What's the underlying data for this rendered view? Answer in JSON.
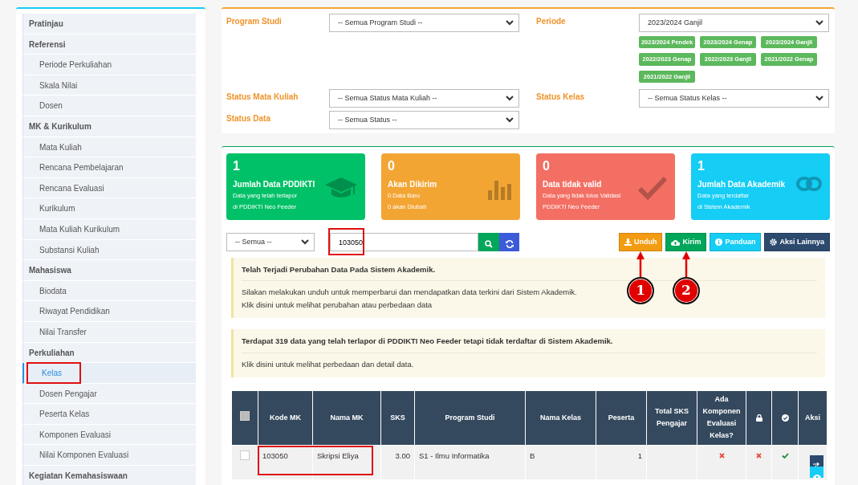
{
  "sidebar": {
    "items": [
      {
        "label": "Pratinjau",
        "kind": "header",
        "selected": false,
        "highlighted": false
      },
      {
        "label": "Referensi",
        "kind": "header",
        "selected": false,
        "highlighted": false
      },
      {
        "label": "Periode Perkuliahan",
        "kind": "link",
        "selected": false,
        "highlighted": false
      },
      {
        "label": "Skala Nilai",
        "kind": "link",
        "selected": false,
        "highlighted": false
      },
      {
        "label": "Dosen",
        "kind": "link",
        "selected": false,
        "highlighted": false
      },
      {
        "label": "MK & Kurikulum",
        "kind": "header",
        "selected": false,
        "highlighted": false
      },
      {
        "label": "Mata Kuliah",
        "kind": "link",
        "selected": false,
        "highlighted": false
      },
      {
        "label": "Rencana Pembelajaran",
        "kind": "link",
        "selected": false,
        "highlighted": false
      },
      {
        "label": "Rencana Evaluasi",
        "kind": "link",
        "selected": false,
        "highlighted": false
      },
      {
        "label": "Kurikulum",
        "kind": "link",
        "selected": false,
        "highlighted": false
      },
      {
        "label": "Mata Kuliah Kurikulum",
        "kind": "link",
        "selected": false,
        "highlighted": false
      },
      {
        "label": "Substansi Kuliah",
        "kind": "link",
        "selected": false,
        "highlighted": false
      },
      {
        "label": "Mahasiswa",
        "kind": "header",
        "selected": false,
        "highlighted": false
      },
      {
        "label": "Biodata",
        "kind": "link",
        "selected": false,
        "highlighted": false
      },
      {
        "label": "Riwayat Pendidikan",
        "kind": "link",
        "selected": false,
        "highlighted": false
      },
      {
        "label": "Nilai Transfer",
        "kind": "link",
        "selected": false,
        "highlighted": false
      },
      {
        "label": "Perkuliahan",
        "kind": "header",
        "selected": false,
        "highlighted": false
      },
      {
        "label": "Kelas",
        "kind": "link",
        "selected": true,
        "highlighted": true
      },
      {
        "label": "Dosen Pengajar",
        "kind": "link",
        "selected": false,
        "highlighted": false
      },
      {
        "label": "Peserta Kelas",
        "kind": "link",
        "selected": false,
        "highlighted": false
      },
      {
        "label": "Komponen Evaluasi",
        "kind": "link",
        "selected": false,
        "highlighted": false
      },
      {
        "label": "Nilai Komponen Evaluasi",
        "kind": "link",
        "selected": false,
        "highlighted": false
      },
      {
        "label": "Kegiatan Kemahasiswaan",
        "kind": "header",
        "selected": false,
        "highlighted": false
      }
    ]
  },
  "filters": {
    "program_studi": {
      "label": "Program Studi",
      "value": "-- Semua Program Studi --"
    },
    "periode": {
      "label": "Periode",
      "value": "2023/2024 Ganjil",
      "quick_periods": [
        "2023/2024 Pendek",
        "2023/2024 Genap",
        "2023/2024 Ganjil",
        "2022/2023 Genap",
        "2022/2023 Ganjil",
        "2021/2022 Genap",
        "2021/2022 Ganjil"
      ]
    },
    "status_mata_kuliah": {
      "label": "Status Mata Kuliah",
      "value": "-- Semua Status Mata Kuliah --"
    },
    "status_kelas": {
      "label": "Status Kelas",
      "value": "-- Semua Status Kelas --"
    },
    "status_data": {
      "label": "Status Data",
      "value": "-- Semua Status --"
    }
  },
  "stats": [
    {
      "count": "1",
      "title": "Jumlah Data PDDIKTI",
      "lines": [
        "Data yang telah terlapor",
        "di PDDIKTI Neo Feeder"
      ],
      "color": "#00c167",
      "kind": "cap"
    },
    {
      "count": "0",
      "title": "Akan Dikirim",
      "lines": [
        "0 Data Baru",
        "0 akan Diubah"
      ],
      "color": "#f3a534",
      "kind": "bars"
    },
    {
      "count": "0",
      "title": "Data tidak valid",
      "lines": [
        "Data yang tidak lolos Validasi",
        "PDDIKTI Neo Feeder"
      ],
      "color": "#f36f63",
      "kind": "check"
    },
    {
      "count": "1",
      "title": "Jumlah Data Akademik",
      "lines": [
        "Data yang terdaftar",
        "di Sistem Akademik"
      ],
      "color": "#15cdf5",
      "kind": "link"
    }
  ],
  "toolbar": {
    "filter_value": "-- Semua --",
    "search": {
      "value": "103050",
      "highlighted": true
    },
    "buttons": [
      {
        "label": "Unduh",
        "kind": "download",
        "color": "#f39c12",
        "callout": "1"
      },
      {
        "label": "Kirim",
        "kind": "upload",
        "color": "#00a65a",
        "callout": "2"
      },
      {
        "label": "Panduan",
        "kind": "info",
        "color": "#15cdf5"
      },
      {
        "label": "Aksi Lainnya",
        "kind": "gear",
        "color": "#2c4a6e"
      }
    ]
  },
  "alerts": [
    {
      "title": "Telah Terjadi Perubahan Data Pada Sistem Akademik.",
      "lines": [
        "Silakan melakukan unduh untuk memperbarui dan mendapatkan data terkini dari Sistem Akademik.",
        "Klik disini untuk melihat perubahan atau perbedaan data"
      ]
    },
    {
      "title": "Terdapat 319 data yang telah terlapor di PDDIKTI Neo Feeder tetapi tidak terdaftar di Sistem Akademik.",
      "lines": [
        "Klik disini untuk melihat perbedaan dan detail data."
      ]
    }
  ],
  "table": {
    "columns": [
      {
        "kind": "checkbox",
        "checked": false
      },
      {
        "kind": "text",
        "label": "Kode MK"
      },
      {
        "kind": "text",
        "label": "Nama MK"
      },
      {
        "kind": "text",
        "label": "SKS"
      },
      {
        "kind": "text",
        "label": "Program Studi"
      },
      {
        "kind": "text",
        "label": "Nama Kelas"
      },
      {
        "kind": "text",
        "label": "Peserta"
      },
      {
        "kind": "text",
        "label": "Total SKS Pengajar"
      },
      {
        "kind": "text",
        "label": "Ada Komponen Evaluasi Kelas?"
      },
      {
        "kind": "lock"
      },
      {
        "kind": "check"
      },
      {
        "kind": "text",
        "label": "Aksi"
      }
    ],
    "rows": [
      {
        "checked": false,
        "highlighted": true,
        "kode_mk": "103050",
        "nama_mk": "Skripsi Eliya",
        "sks": "3.00",
        "program_studi": "S1 - Ilmu Informatika",
        "nama_kelas": "B",
        "peserta": "1",
        "ada_komponen_evaluasi": false,
        "locked": false,
        "valid": true
      }
    ]
  }
}
